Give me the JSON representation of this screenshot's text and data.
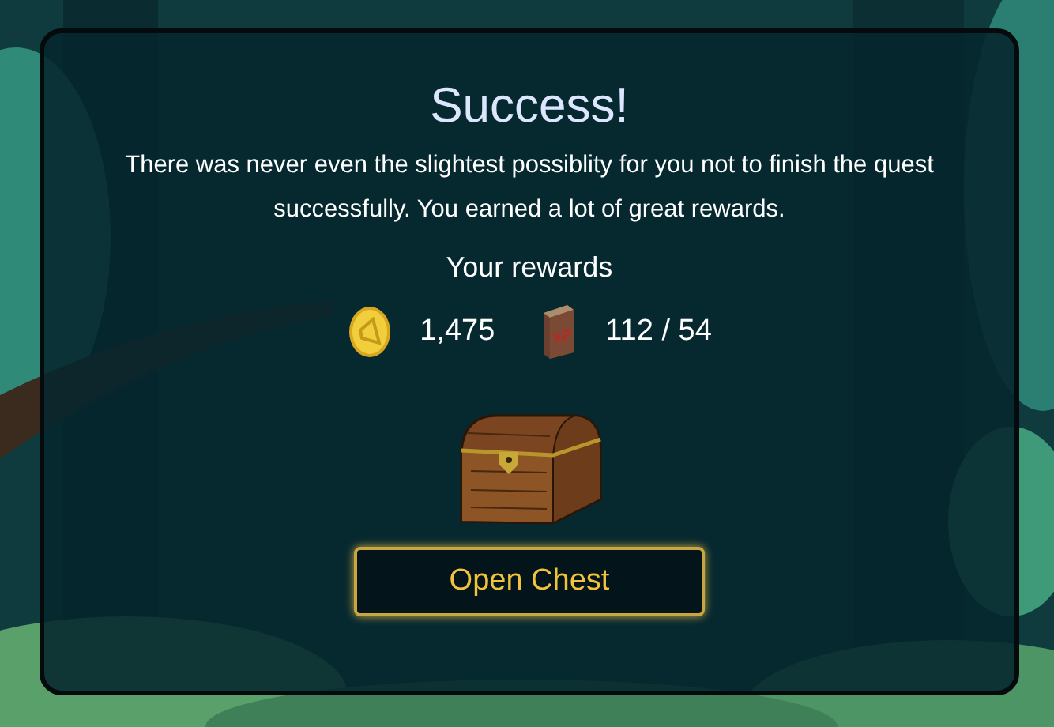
{
  "dialog": {
    "title": "Success!",
    "message": "There was never even the slightest possiblity for you not to finish the quest successfully. You earned a lot of great rewards.",
    "rewards_heading": "Your rewards",
    "rewards": [
      {
        "kind": "coin",
        "amount": "1,475"
      },
      {
        "kind": "book",
        "icon_text": "XP",
        "amount": "112 / 54"
      }
    ],
    "chest": {
      "kind": "chest"
    },
    "button": "Open Chest"
  }
}
